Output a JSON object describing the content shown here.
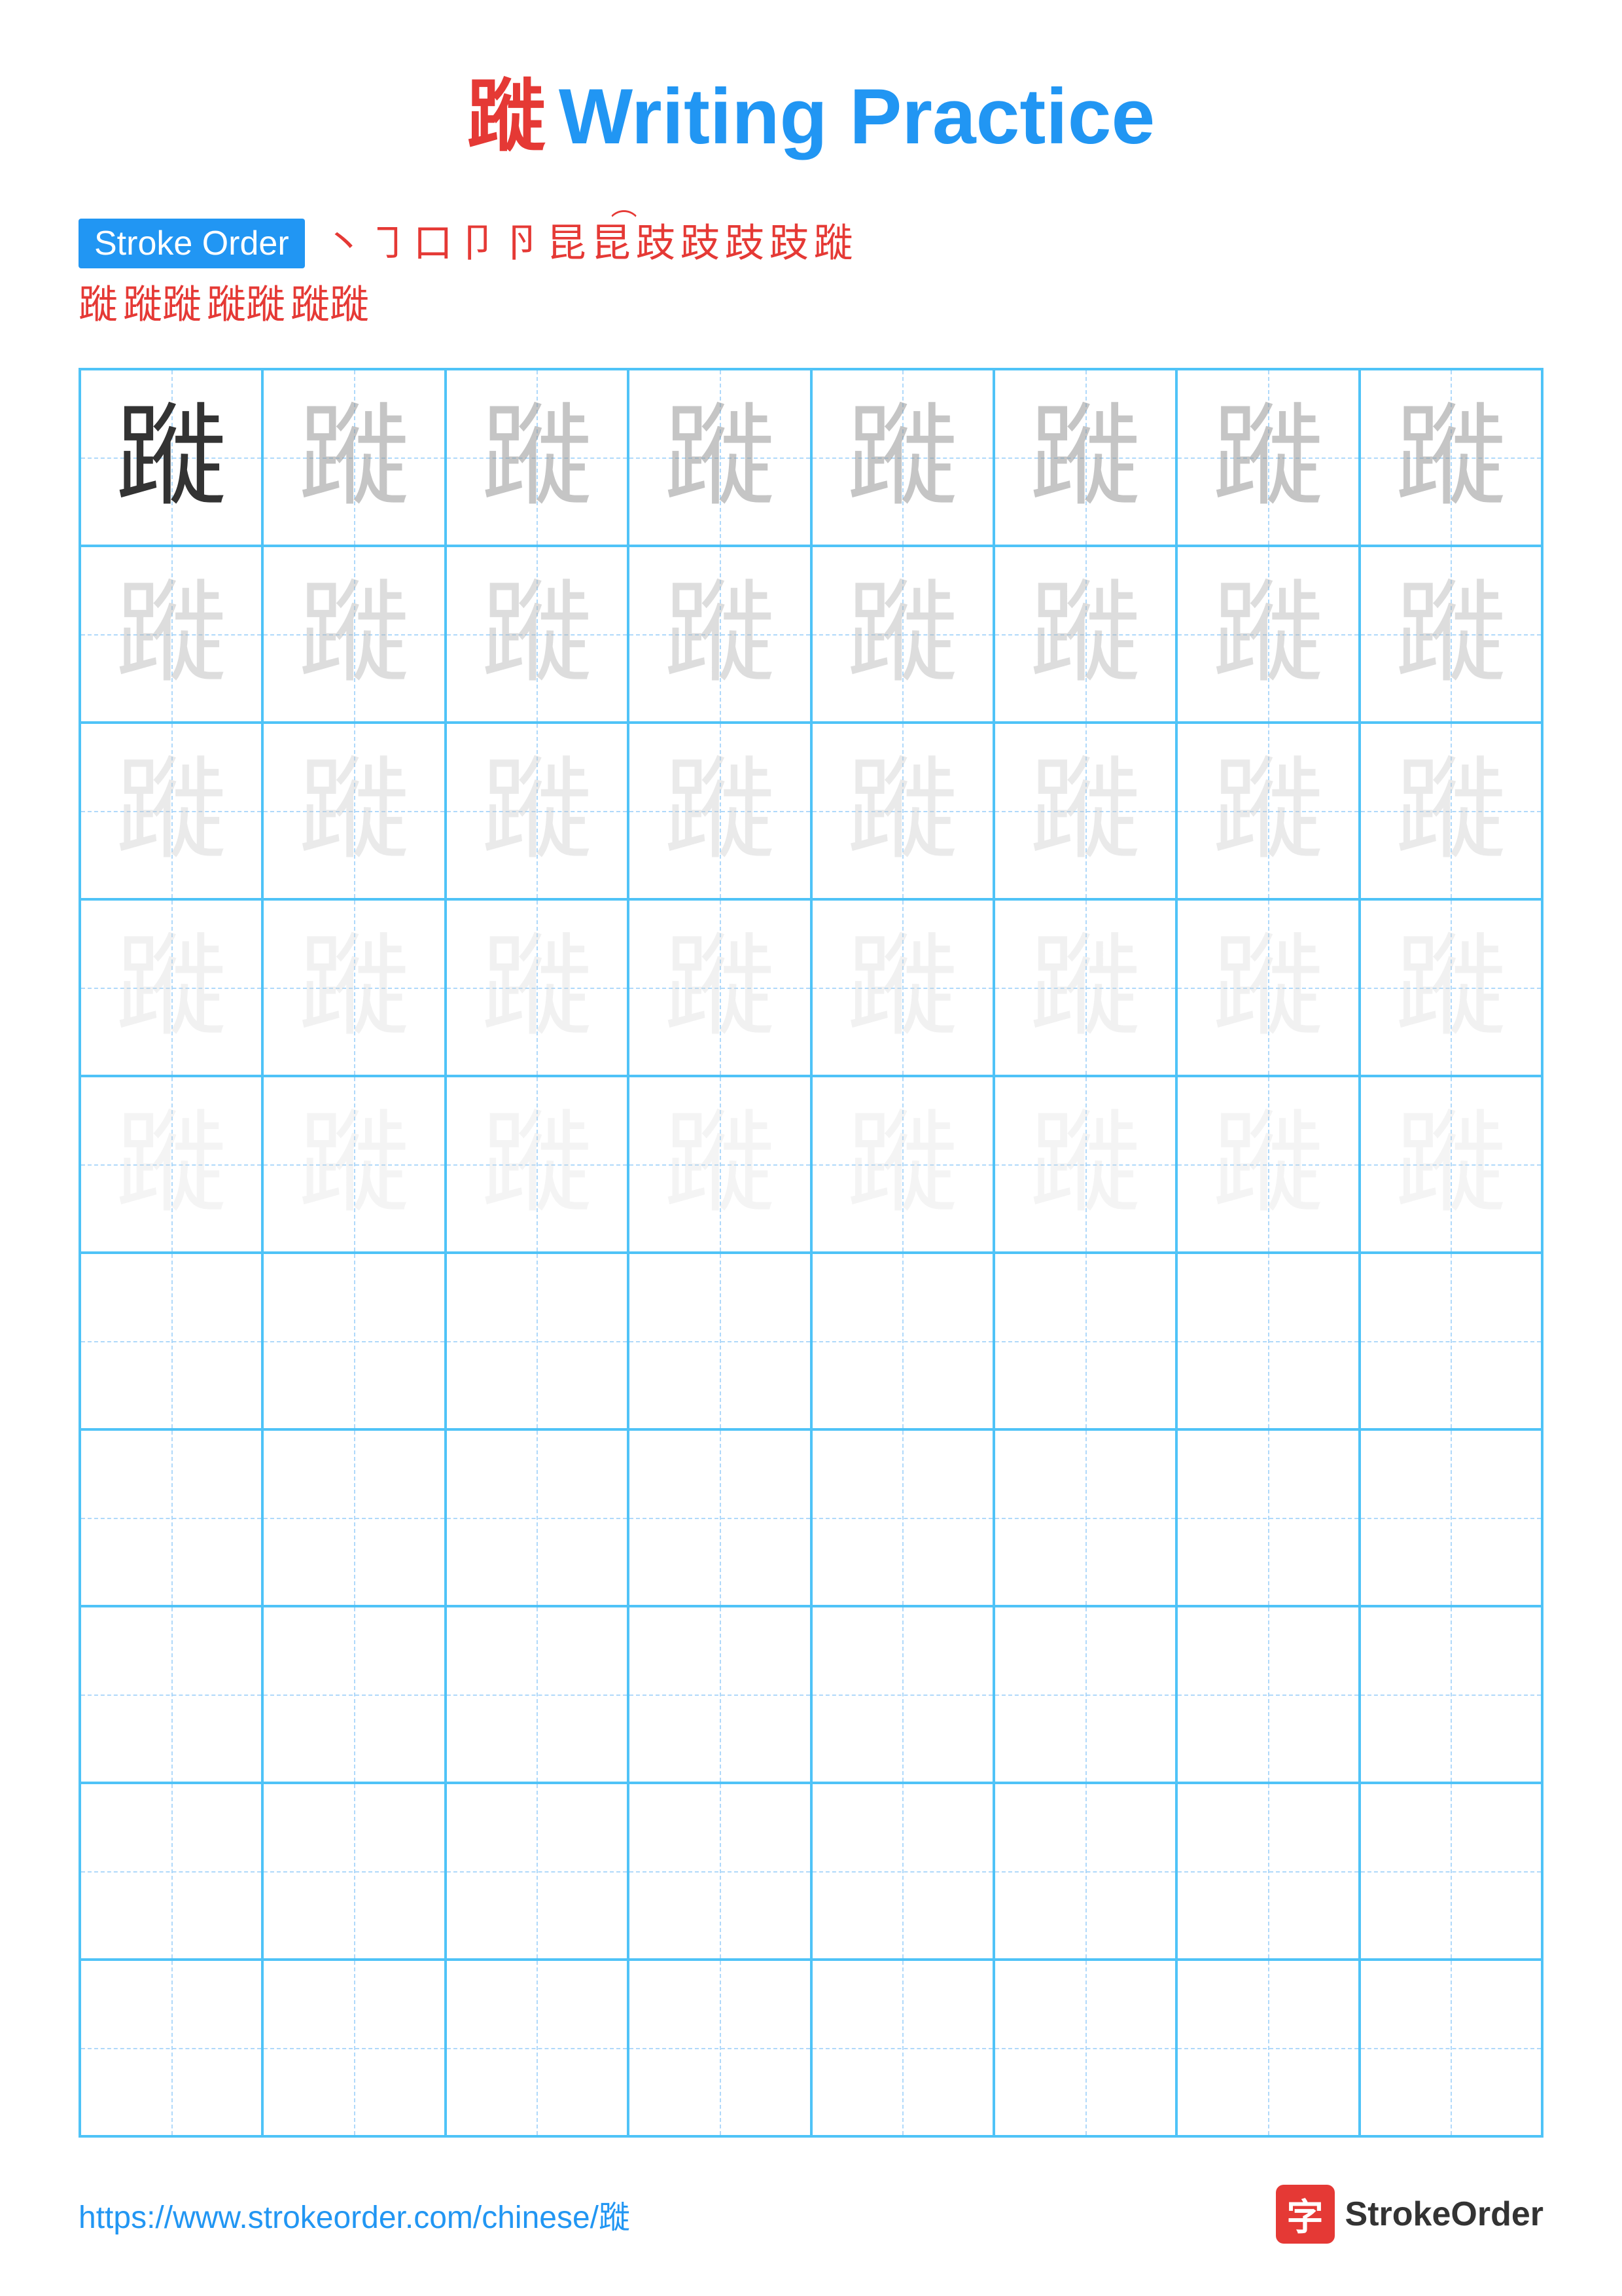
{
  "title": {
    "char": "蹝",
    "rest": " Writing Practice"
  },
  "strokeOrder": {
    "label": "Stroke Order",
    "sequence": [
      "丶",
      "㇆",
      "口",
      "卩",
      "卪",
      "昆",
      "昆",
      "昆⁻",
      "跂",
      "跂",
      "跂",
      "跂",
      "蹝",
      "蹝蹝",
      "蹝蹝",
      "蹝蹝"
    ]
  },
  "grid": {
    "rows": 10,
    "cols": 8,
    "char": "蹝"
  },
  "footer": {
    "url": "https://www.strokeorder.com/chinese/蹝",
    "logoChar": "字",
    "logoText": "StrokeOrder"
  }
}
